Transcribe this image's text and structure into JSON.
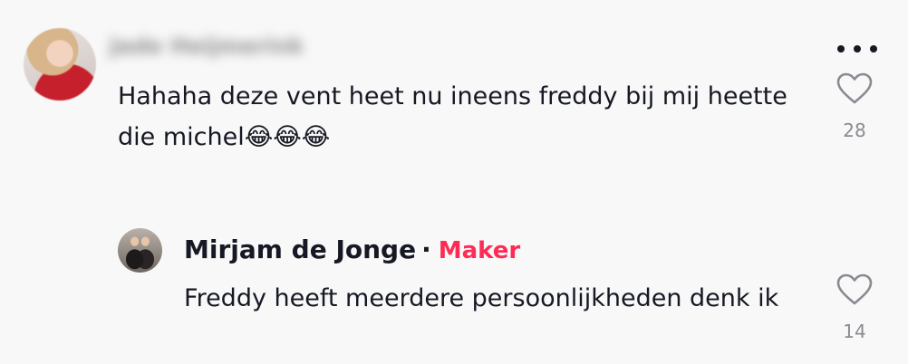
{
  "comment": {
    "author_name": "Jade Heijmerink",
    "text": "Hahaha deze vent heet nu ineens freddy bij mij heette die michel😂😂😂",
    "like_count": "28"
  },
  "reply": {
    "author_name": "Mirjam de Jonge",
    "separator": "·",
    "badge": "Maker",
    "text": "Freddy heeft meerdere persoonlijkheden denk ik",
    "like_count": "14"
  },
  "icons": {
    "more": "more-options-icon",
    "like": "heart-icon"
  },
  "colors": {
    "text": "#161823",
    "muted": "#8a8b91",
    "maker_badge": "#fe2c55",
    "background": "#f8f8f8"
  }
}
